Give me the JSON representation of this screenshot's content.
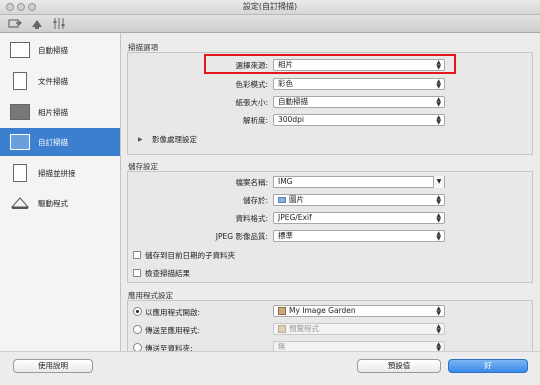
{
  "window": {
    "title": "設定(自訂掃描)"
  },
  "sidebar": {
    "items": [
      {
        "label": "自動掃描",
        "icon": "auto-scan-icon",
        "active": false
      },
      {
        "label": "文件掃描",
        "icon": "document-scan-icon",
        "active": false
      },
      {
        "label": "相片掃描",
        "icon": "photo-scan-icon",
        "active": false
      },
      {
        "label": "自訂掃描",
        "icon": "custom-scan-icon",
        "active": true
      },
      {
        "label": "掃描並拼接",
        "icon": "stitch-scan-icon",
        "active": false
      },
      {
        "label": "驅動程式",
        "icon": "driver-icon",
        "active": false
      }
    ]
  },
  "scan_options": {
    "section_title": "掃描選項",
    "source_label": "選擇來源:",
    "source_value": "相片",
    "color_label": "色彩模式:",
    "color_value": "彩色",
    "paper_label": "紙張大小:",
    "paper_value": "自動掃描",
    "resolution_label": "解析度:",
    "resolution_value": "300dpi",
    "image_processing": "影像處理設定"
  },
  "save_settings": {
    "section_title": "儲存設定",
    "filename_label": "檔案名稱:",
    "filename_value": "IMG",
    "save_in_label": "儲存於:",
    "save_in_value": "圖片",
    "format_label": "資料格式:",
    "format_value": "JPEG/Exif",
    "quality_label": "JPEG 影像品質:",
    "quality_value": "標準",
    "subfolder_label": "儲存到目前日期的子資料夾",
    "check_result_label": "檢查掃描結果"
  },
  "app_settings": {
    "section_title": "應用程式設定",
    "open_with_label": "以應用程式開啟:",
    "open_with_value": "My Image Garden",
    "send_to_app_label": "傳送至應用程式:",
    "send_to_app_value": "預覽程式",
    "send_to_folder_label": "傳送至資料夾:",
    "send_to_folder_value": "無"
  },
  "footer": {
    "help": "使用說明",
    "defaults": "預設值",
    "ok": "好"
  },
  "colors": {
    "accent": "#3d7fcf",
    "highlight": "#e4161b"
  }
}
